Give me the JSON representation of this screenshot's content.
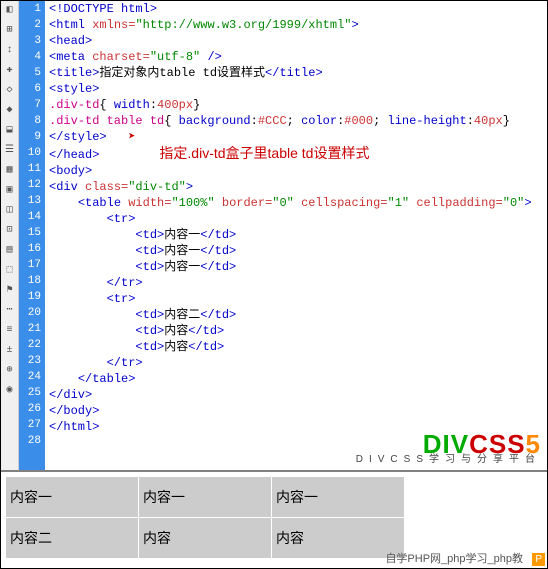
{
  "lines": [
    "1",
    "2",
    "3",
    "4",
    "5",
    "6",
    "7",
    "8",
    "9",
    "10",
    "11",
    "12",
    "13",
    "14",
    "15",
    "16",
    "17",
    "18",
    "19",
    "20",
    "21",
    "22",
    "23",
    "24",
    "25",
    "26",
    "27",
    "28"
  ],
  "code": {
    "l1": "<!DOCTYPE html>",
    "l2a": "<html",
    "l2b": " xmlns=",
    "l2c": "\"http://www.w3.org/1999/xhtml\"",
    "l2d": ">",
    "l3": "<head>",
    "l4a": "<meta",
    "l4b": " charset=",
    "l4c": "\"utf-8\"",
    "l4d": " />",
    "l5a": "<title>",
    "l5b": "指定对象内table td设置样式",
    "l5c": "</title>",
    "l6": "<style>",
    "l7a": ".div-td",
    "l7b": "{ ",
    "l7c": "width",
    "l7d": ":",
    "l7e": "400px",
    "l7f": "}",
    "l8a": ".div-td table td",
    "l8b": "{ ",
    "l8c": "background",
    "l8d": ":",
    "l8e": "#CCC",
    "l8f": "; ",
    "l8g": "color",
    "l8h": ":",
    "l8i": "#000",
    "l8j": "; ",
    "l8k": "line-height",
    "l8l": ":",
    "l8m": "40px",
    "l8n": "}",
    "l9": "</style>",
    "l10": "</head>",
    "l11": "<body>",
    "l12a": "<div",
    "l12b": " class=",
    "l12c": "\"div-td\"",
    "l12d": ">",
    "l13a": "<table",
    "l13b": " width=",
    "l13c": "\"100%\"",
    "l13d": " border=",
    "l13e": "\"0\"",
    "l13f": " cellspacing=",
    "l13g": "\"1\"",
    "l13h": " cellpadding=",
    "l13i": "\"0\"",
    "l13j": ">",
    "l14": "<tr>",
    "l15a": "<td>",
    "l15b": "内容一",
    "l15c": "</td>",
    "l16a": "<td>",
    "l16b": "内容一",
    "l16c": "</td>",
    "l17a": "<td>",
    "l17b": "内容一",
    "l17c": "</td>",
    "l18": "</tr>",
    "l19": "<tr>",
    "l20a": "<td>",
    "l20b": "内容二",
    "l20c": "</td>",
    "l21a": "<td>",
    "l21b": "内容",
    "l21c": "</td>",
    "l22a": "<td>",
    "l22b": "内容",
    "l22c": "</td>",
    "l23": "</tr>",
    "l24": "</table>",
    "l25": "</div>",
    "l26": "</body>",
    "l27": "</html>"
  },
  "annotation": "指定.div-td盒子里table td设置样式",
  "logo": {
    "d": "D",
    "i": "I",
    "v": "V",
    "c": "C",
    "s1": "S",
    "s2": "S",
    "five": "5",
    "sub": "DIVCSS学习与分享平台"
  },
  "preview": {
    "r1c1": "内容一",
    "r1c2": "内容一",
    "r1c3": "内容一",
    "r2c1": "内容二",
    "r2c2": "内容",
    "r2c3": "内容"
  },
  "footer": {
    "text": "自学PHP网_php学习_php教",
    "badge": "P"
  }
}
